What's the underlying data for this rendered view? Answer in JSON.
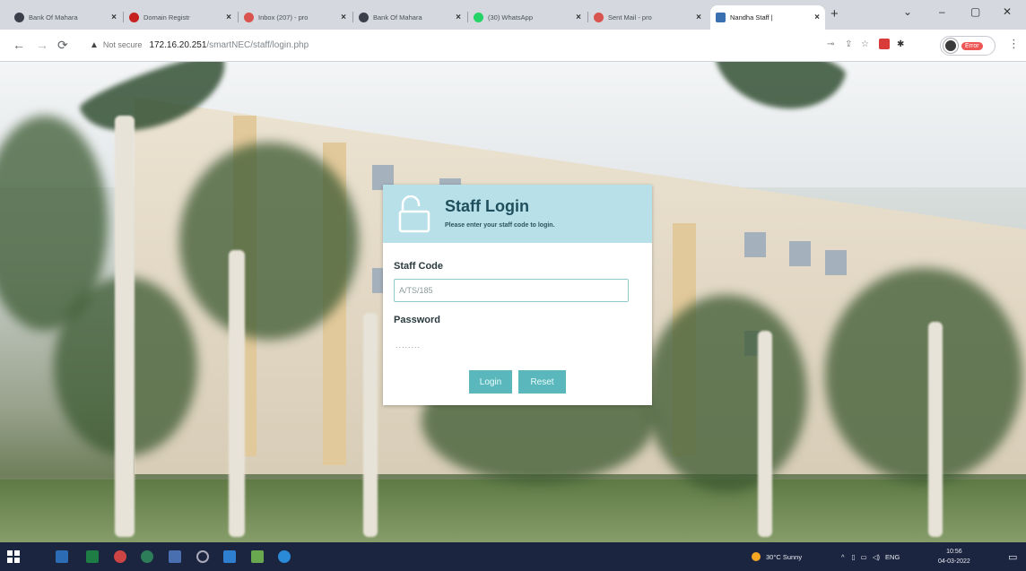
{
  "tabs": [
    {
      "label": "Bank Of Mahara",
      "favicon_color": "#3b3f4a"
    },
    {
      "label": "Domain Registr",
      "favicon_color": "#c5221f"
    },
    {
      "label": "Inbox (207) - pro",
      "favicon_color": "#d9534f"
    },
    {
      "label": "Bank Of Mahara",
      "favicon_color": "#3b3f4a"
    },
    {
      "label": "(30) WhatsApp",
      "favicon_color": "#25d366"
    },
    {
      "label": "Sent Mail - pro",
      "favicon_color": "#d9534f"
    },
    {
      "label": "Nandha Staff |",
      "favicon_color": "#3a6fb0",
      "active": true
    }
  ],
  "window_controls": {
    "dropdown": "⌄",
    "minimize": "–",
    "maximize": "▢",
    "close": "✕"
  },
  "address_bar": {
    "security_label": "Not secure",
    "host": "172.16.20.251",
    "path": "/smartNEC/staff/login.php",
    "profile_badge": "Error"
  },
  "login": {
    "title": "Staff Login",
    "subtitle": "Please enter your staff code to login.",
    "staff_code_label": "Staff Code",
    "staff_code_value": "A/TS/185",
    "password_label": "Password",
    "password_value": "........",
    "login_button": "Login",
    "reset_button": "Reset"
  },
  "taskbar": {
    "weather": "30°C  Sunny",
    "language": "ENG",
    "time": "10:56",
    "date": "04-03-2022"
  },
  "colors": {
    "card_header": "#b8e0e8",
    "button": "#5ab8bc",
    "taskbar": "#1c2540",
    "active_tab": "#ffffff"
  }
}
